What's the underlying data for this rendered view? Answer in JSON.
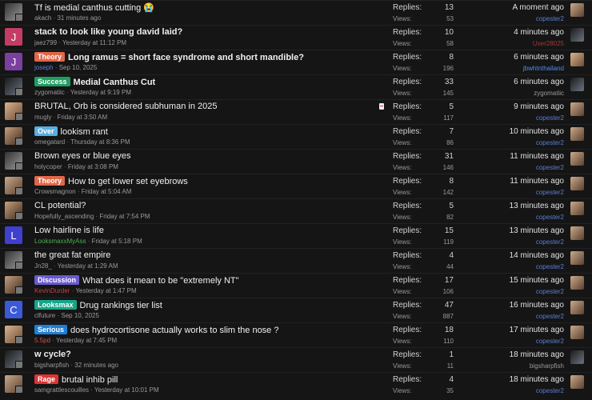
{
  "labels": {
    "replies": "Replies:",
    "views": "Views:"
  },
  "threads": [
    {
      "avatar": "photo",
      "avatar_style": "g2",
      "avatar_letter": "",
      "avatar_color": "",
      "badge": "",
      "badge_color": "",
      "title": "Tf is medial canthus cutting 😭",
      "bold": false,
      "author": "akach",
      "author_color": "#9a9a9a",
      "date": "31 minutes ago",
      "replies": "13",
      "views": "53",
      "time": "A moment ago",
      "last_user": "copester2",
      "last_user_color": "#5b7fd6",
      "last_avatar": "g1",
      "doc": false
    },
    {
      "avatar": "letter",
      "avatar_style": "",
      "avatar_letter": "J",
      "avatar_color": "#c43c64",
      "badge": "",
      "badge_color": "",
      "title": "stack to look like young david laid?",
      "bold": true,
      "author": "jaez799",
      "author_color": "#9a9a9a",
      "date": "Yesterday at 11:12 PM",
      "replies": "10",
      "views": "58",
      "time": "4 minutes ago",
      "last_user": "User28025",
      "last_user_color": "#b03030",
      "last_avatar": "g4",
      "doc": false
    },
    {
      "avatar": "letter",
      "avatar_style": "",
      "avatar_letter": "J",
      "avatar_color": "#7b3fa0",
      "badge": "Theory",
      "badge_color": "#e0674a",
      "title": "Long ramus = short face syndrome and short mandible?",
      "bold": true,
      "author": "joseph",
      "author_color": "#5b7fd6",
      "date": "Sep 10, 2025",
      "replies": "8",
      "views": "196",
      "time": "6 minutes ago",
      "last_user": "jbwhtnthailand",
      "last_user_color": "#4c8ef0",
      "last_avatar": "g3",
      "doc": false
    },
    {
      "avatar": "photo",
      "avatar_style": "g4",
      "avatar_letter": "",
      "avatar_color": "",
      "badge": "Success",
      "badge_color": "#1f9d62",
      "title": "Medial Canthus Cut",
      "bold": true,
      "author": "zygomatiic",
      "author_color": "#9a9a9a",
      "date": "Yesterday at 9:19 PM",
      "replies": "33",
      "views": "145",
      "time": "6 minutes ago",
      "last_user": "zygomatiic",
      "last_user_color": "#9a9a9a",
      "last_avatar": "g4",
      "doc": false
    },
    {
      "avatar": "photo",
      "avatar_style": "g3",
      "avatar_letter": "",
      "avatar_color": "",
      "badge": "",
      "badge_color": "",
      "title": "BRUTAL, Orb is considered subhuman in 2025",
      "bold": false,
      "author": "mugly",
      "author_color": "#9a9a9a",
      "date": "Friday at 3:50 AM",
      "replies": "5",
      "views": "117",
      "time": "9 minutes ago",
      "last_user": "copester2",
      "last_user_color": "#5b7fd6",
      "last_avatar": "g1",
      "doc": true
    },
    {
      "avatar": "photo",
      "avatar_style": "g5",
      "avatar_letter": "",
      "avatar_color": "",
      "badge": "Over",
      "badge_color": "#5aaee0",
      "title": "lookism rant",
      "bold": false,
      "author": "omegatard",
      "author_color": "#9a9a9a",
      "date": "Thursday at 8:36 PM",
      "replies": "7",
      "views": "86",
      "time": "10 minutes ago",
      "last_user": "copester2",
      "last_user_color": "#5b7fd6",
      "last_avatar": "g1",
      "doc": false
    },
    {
      "avatar": "photo",
      "avatar_style": "g2",
      "avatar_letter": "",
      "avatar_color": "",
      "badge": "",
      "badge_color": "",
      "title": "Brown eyes or blue eyes",
      "bold": false,
      "author": "holycoper",
      "author_color": "#9a9a9a",
      "date": "Friday at 3:08 PM",
      "replies": "31",
      "views": "146",
      "time": "11 minutes ago",
      "last_user": "copester2",
      "last_user_color": "#5b7fd6",
      "last_avatar": "g1",
      "doc": false
    },
    {
      "avatar": "photo",
      "avatar_style": "g1",
      "avatar_letter": "",
      "avatar_color": "",
      "badge": "Theory",
      "badge_color": "#e0674a",
      "title": "How to get lower set eyebrows",
      "bold": false,
      "author": "Crowsmagnon",
      "author_color": "#9a9a9a",
      "date": "Friday at 5:04 AM",
      "replies": "8",
      "views": "142",
      "time": "11 minutes ago",
      "last_user": "copester2",
      "last_user_color": "#5b7fd6",
      "last_avatar": "g1",
      "doc": false
    },
    {
      "avatar": "photo",
      "avatar_style": "g5",
      "avatar_letter": "",
      "avatar_color": "",
      "badge": "",
      "badge_color": "",
      "title": "CL potential?",
      "bold": false,
      "author": "Hopefully_ascending",
      "author_color": "#9a9a9a",
      "date": "Friday at 7:54 PM",
      "replies": "5",
      "views": "82",
      "time": "13 minutes ago",
      "last_user": "copester2",
      "last_user_color": "#5b7fd6",
      "last_avatar": "g1",
      "doc": false
    },
    {
      "avatar": "letter",
      "avatar_style": "",
      "avatar_letter": "L",
      "avatar_color": "#3f3fd0",
      "badge": "",
      "badge_color": "",
      "title": "Low hairline is life",
      "bold": false,
      "author": "LooksmaxxMyAss",
      "author_color": "#4caf50",
      "date": "Friday at 5:18 PM",
      "replies": "15",
      "views": "119",
      "time": "13 minutes ago",
      "last_user": "copester2",
      "last_user_color": "#5b7fd6",
      "last_avatar": "g1",
      "doc": false
    },
    {
      "avatar": "photo",
      "avatar_style": "g2",
      "avatar_letter": "",
      "avatar_color": "",
      "badge": "",
      "badge_color": "",
      "title": "the great fat empire",
      "bold": false,
      "author": "Jn28_",
      "author_color": "#9a9a9a",
      "date": "Yesterday at 1:29 AM",
      "replies": "4",
      "views": "44",
      "time": "14 minutes ago",
      "last_user": "copester2",
      "last_user_color": "#5b7fd6",
      "last_avatar": "g1",
      "doc": false
    },
    {
      "avatar": "photo",
      "avatar_style": "g5",
      "avatar_letter": "",
      "avatar_color": "",
      "badge": "Discussion",
      "badge_color": "#6a5acd",
      "title": "What does it mean to be \"extremely NT\"",
      "bold": false,
      "author": "KevinDurder",
      "author_color": "#c24040",
      "date": "Yesterday at 1:47 PM",
      "replies": "17",
      "views": "106",
      "time": "15 minutes ago",
      "last_user": "copester2",
      "last_user_color": "#5b7fd6",
      "last_avatar": "g1",
      "doc": false
    },
    {
      "avatar": "letter",
      "avatar_style": "",
      "avatar_letter": "C",
      "avatar_color": "#3a5ad8",
      "badge": "Looksmax",
      "badge_color": "#17a589",
      "title": "Drug rankings tier list",
      "bold": false,
      "author": "clfuture",
      "author_color": "#9a9a9a",
      "date": "Sep 10, 2025",
      "replies": "47",
      "views": "887",
      "time": "16 minutes ago",
      "last_user": "copester2",
      "last_user_color": "#5b7fd6",
      "last_avatar": "g1",
      "doc": false
    },
    {
      "avatar": "photo",
      "avatar_style": "g3",
      "avatar_letter": "",
      "avatar_color": "",
      "badge": "Serious",
      "badge_color": "#1e7fd6",
      "title": "does hydrocortisone actually works to slim the nose ?",
      "bold": false,
      "author": "5.5pd",
      "author_color": "#d05050",
      "date": "Yesterday at 7:45 PM",
      "replies": "18",
      "views": "110",
      "time": "17 minutes ago",
      "last_user": "copester2",
      "last_user_color": "#5b7fd6",
      "last_avatar": "g1",
      "doc": false
    },
    {
      "avatar": "photo",
      "avatar_style": "g4",
      "avatar_letter": "",
      "avatar_color": "",
      "badge": "",
      "badge_color": "",
      "title": "w cycle?",
      "bold": true,
      "author": "bigsharpfish",
      "author_color": "#9a9a9a",
      "date": "32 minutes ago",
      "replies": "1",
      "views": "11",
      "time": "18 minutes ago",
      "last_user": "bigsharpfish",
      "last_user_color": "#9a9a9a",
      "last_avatar": "g4",
      "doc": false
    },
    {
      "avatar": "photo",
      "avatar_style": "g1",
      "avatar_letter": "",
      "avatar_color": "",
      "badge": "Rage",
      "badge_color": "#d93535",
      "title": "brutal inhib pill",
      "bold": false,
      "author": "samgrattlescouilles",
      "author_color": "#9a9a9a",
      "date": "Yesterday at 10:01 PM",
      "replies": "4",
      "views": "35",
      "time": "18 minutes ago",
      "last_user": "copester2",
      "last_user_color": "#5b7fd6",
      "last_avatar": "g1",
      "doc": false
    }
  ]
}
